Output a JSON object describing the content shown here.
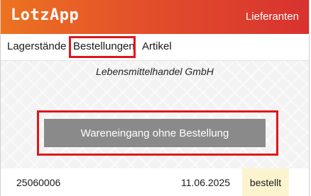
{
  "header": {
    "app_title": "LotzApp",
    "supplier_link": "Lieferanten"
  },
  "tabs": [
    {
      "label": "Lagerstände",
      "highlighted": false
    },
    {
      "label": "Bestellungen",
      "highlighted": true
    },
    {
      "label": "Artikel",
      "highlighted": false
    }
  ],
  "main": {
    "company_name": "Lebensmittelhandel GmbH",
    "goods_receipt_button": "Wareneingang ohne Bestellung",
    "orders": [
      {
        "number": "25060006",
        "date": "11.06.2025",
        "status": "bestellt"
      }
    ]
  },
  "colors": {
    "header_start": "#ec7321",
    "header_end": "#d8322f",
    "highlight_box": "#e0161b",
    "button_bg": "#8a8a8a",
    "status_bg": "#fcf4cf"
  }
}
